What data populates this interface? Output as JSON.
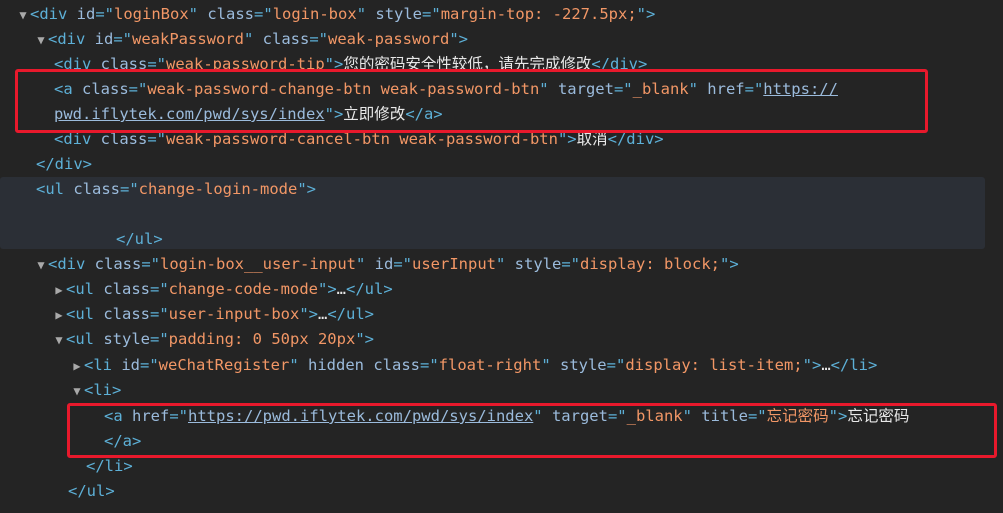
{
  "lines": [
    {
      "id": "l1",
      "toggle": "▼",
      "tokens": [
        {
          "t": "tag",
          "v": "<div "
        },
        {
          "t": "attr",
          "v": "id"
        },
        {
          "t": "tag",
          "v": "=\""
        },
        {
          "t": "val",
          "v": "loginBox"
        },
        {
          "t": "tag",
          "v": "\" "
        },
        {
          "t": "attr",
          "v": "class"
        },
        {
          "t": "tag",
          "v": "=\""
        },
        {
          "t": "val",
          "v": "login-box"
        },
        {
          "t": "tag",
          "v": "\" "
        },
        {
          "t": "attr",
          "v": "style"
        },
        {
          "t": "tag",
          "v": "=\""
        },
        {
          "t": "val",
          "v": "margin-top: -227.5px;"
        },
        {
          "t": "tag",
          "v": "\">"
        }
      ]
    },
    {
      "id": "l2",
      "toggle": "▼",
      "tokens": [
        {
          "t": "tag",
          "v": "<div "
        },
        {
          "t": "attr",
          "v": "id"
        },
        {
          "t": "tag",
          "v": "=\""
        },
        {
          "t": "val",
          "v": "weakPassword"
        },
        {
          "t": "tag",
          "v": "\" "
        },
        {
          "t": "attr",
          "v": "class"
        },
        {
          "t": "tag",
          "v": "=\""
        },
        {
          "t": "val",
          "v": "weak-password"
        },
        {
          "t": "tag",
          "v": "\">"
        }
      ]
    },
    {
      "id": "l3",
      "toggle": "",
      "tokens": [
        {
          "t": "tag",
          "v": "<div "
        },
        {
          "t": "attr",
          "v": "class"
        },
        {
          "t": "tag",
          "v": "=\""
        },
        {
          "t": "val",
          "v": "weak-password-tip"
        },
        {
          "t": "tag",
          "v": "\">"
        },
        {
          "t": "txt",
          "v": "您的密码安全性较低，请先完成修改"
        },
        {
          "t": "tag",
          "v": "</div>"
        }
      ]
    },
    {
      "id": "l4",
      "toggle": "",
      "tokens": [
        {
          "t": "tag",
          "v": "<a "
        },
        {
          "t": "attr",
          "v": "class"
        },
        {
          "t": "tag",
          "v": "=\""
        },
        {
          "t": "val",
          "v": "weak-password-change-btn weak-password-btn"
        },
        {
          "t": "tag",
          "v": "\" "
        },
        {
          "t": "attr",
          "v": "target"
        },
        {
          "t": "tag",
          "v": "=\""
        },
        {
          "t": "val",
          "v": "_blank"
        },
        {
          "t": "tag",
          "v": "\" "
        },
        {
          "t": "attr",
          "v": "href"
        },
        {
          "t": "tag",
          "v": "=\""
        },
        {
          "t": "link",
          "v": "https://"
        }
      ]
    },
    {
      "id": "l5",
      "toggle": "",
      "tokens": [
        {
          "t": "link",
          "v": "pwd.iflytek.com/pwd/sys/index"
        },
        {
          "t": "tag",
          "v": "\">"
        },
        {
          "t": "txt",
          "v": "立即修改"
        },
        {
          "t": "tag",
          "v": "</a>"
        }
      ]
    },
    {
      "id": "l6",
      "toggle": "",
      "tokens": [
        {
          "t": "tag",
          "v": "<div "
        },
        {
          "t": "attr",
          "v": "class"
        },
        {
          "t": "tag",
          "v": "=\""
        },
        {
          "t": "val",
          "v": "weak-password-cancel-btn weak-password-btn"
        },
        {
          "t": "tag",
          "v": "\">"
        },
        {
          "t": "txt",
          "v": "取消"
        },
        {
          "t": "tag",
          "v": "</div>"
        }
      ]
    },
    {
      "id": "l7",
      "toggle": "",
      "tokens": [
        {
          "t": "tag",
          "v": "</div>"
        }
      ]
    },
    {
      "id": "l8",
      "toggle": "",
      "tokens": [
        {
          "t": "tag",
          "v": "<ul "
        },
        {
          "t": "attr",
          "v": "class"
        },
        {
          "t": "tag",
          "v": "=\""
        },
        {
          "t": "val",
          "v": "change-login-mode"
        },
        {
          "t": "tag",
          "v": "\">"
        }
      ]
    },
    {
      "id": "l9",
      "toggle": "",
      "tokens": [
        {
          "t": "tag",
          "v": "</ul>"
        }
      ]
    },
    {
      "id": "l10",
      "toggle": "▼",
      "tokens": [
        {
          "t": "tag",
          "v": "<div "
        },
        {
          "t": "attr",
          "v": "class"
        },
        {
          "t": "tag",
          "v": "=\""
        },
        {
          "t": "val",
          "v": "login-box__user-input"
        },
        {
          "t": "tag",
          "v": "\" "
        },
        {
          "t": "attr",
          "v": "id"
        },
        {
          "t": "tag",
          "v": "=\""
        },
        {
          "t": "val",
          "v": "userInput"
        },
        {
          "t": "tag",
          "v": "\" "
        },
        {
          "t": "attr",
          "v": "style"
        },
        {
          "t": "tag",
          "v": "=\""
        },
        {
          "t": "val",
          "v": "display: block;"
        },
        {
          "t": "tag",
          "v": "\">"
        }
      ]
    },
    {
      "id": "l11",
      "toggle": "▶",
      "tokens": [
        {
          "t": "tag",
          "v": "<ul "
        },
        {
          "t": "attr",
          "v": "class"
        },
        {
          "t": "tag",
          "v": "=\""
        },
        {
          "t": "val",
          "v": "change-code-mode"
        },
        {
          "t": "tag",
          "v": "\">"
        },
        {
          "t": "ell",
          "v": "…"
        },
        {
          "t": "tag",
          "v": "</ul>"
        }
      ]
    },
    {
      "id": "l12",
      "toggle": "▶",
      "tokens": [
        {
          "t": "tag",
          "v": "<ul "
        },
        {
          "t": "attr",
          "v": "class"
        },
        {
          "t": "tag",
          "v": "=\""
        },
        {
          "t": "val",
          "v": "user-input-box"
        },
        {
          "t": "tag",
          "v": "\">"
        },
        {
          "t": "ell",
          "v": "…"
        },
        {
          "t": "tag",
          "v": "</ul>"
        }
      ]
    },
    {
      "id": "l13",
      "toggle": "▼",
      "tokens": [
        {
          "t": "tag",
          "v": "<ul "
        },
        {
          "t": "attr",
          "v": "style"
        },
        {
          "t": "tag",
          "v": "=\""
        },
        {
          "t": "val",
          "v": "padding: 0 50px 20px"
        },
        {
          "t": "tag",
          "v": "\">"
        }
      ]
    },
    {
      "id": "l14",
      "toggle": "▶",
      "tokens": [
        {
          "t": "tag",
          "v": "<li "
        },
        {
          "t": "attr",
          "v": "id"
        },
        {
          "t": "tag",
          "v": "=\""
        },
        {
          "t": "val",
          "v": "weChatRegister"
        },
        {
          "t": "tag",
          "v": "\" "
        },
        {
          "t": "attr",
          "v": "hidden class"
        },
        {
          "t": "tag",
          "v": "=\""
        },
        {
          "t": "val",
          "v": "float-right"
        },
        {
          "t": "tag",
          "v": "\" "
        },
        {
          "t": "attr",
          "v": "style"
        },
        {
          "t": "tag",
          "v": "=\""
        },
        {
          "t": "val",
          "v": "display: list-item;"
        },
        {
          "t": "tag",
          "v": "\">"
        },
        {
          "t": "ell",
          "v": "…"
        },
        {
          "t": "tag",
          "v": "</li>"
        }
      ]
    },
    {
      "id": "l15",
      "toggle": "▼",
      "tokens": [
        {
          "t": "tag",
          "v": "<li>"
        }
      ]
    },
    {
      "id": "l16",
      "toggle": "",
      "tokens": [
        {
          "t": "tag",
          "v": "<a "
        },
        {
          "t": "attr",
          "v": "href"
        },
        {
          "t": "tag",
          "v": "=\""
        },
        {
          "t": "link",
          "v": "https://pwd.iflytek.com/pwd/sys/index"
        },
        {
          "t": "tag",
          "v": "\" "
        },
        {
          "t": "attr",
          "v": "target"
        },
        {
          "t": "tag",
          "v": "=\""
        },
        {
          "t": "val",
          "v": "_blank"
        },
        {
          "t": "tag",
          "v": "\" "
        },
        {
          "t": "attr",
          "v": "title"
        },
        {
          "t": "tag",
          "v": "=\""
        },
        {
          "t": "val",
          "v": "忘记密码"
        },
        {
          "t": "tag",
          "v": "\">"
        },
        {
          "t": "txt",
          "v": "忘记密码"
        }
      ]
    },
    {
      "id": "l17",
      "toggle": "",
      "tokens": [
        {
          "t": "tag",
          "v": "</a>"
        }
      ]
    },
    {
      "id": "l18",
      "toggle": "",
      "tokens": [
        {
          "t": "tag",
          "v": "</li>"
        }
      ]
    },
    {
      "id": "l19",
      "toggle": "",
      "tokens": [
        {
          "t": "tag",
          "v": "</ul>"
        }
      ]
    }
  ],
  "colors": {
    "background": "#242424",
    "tag": "#5db0d7",
    "attribute": "#9bbbdc",
    "value": "#f29766",
    "text": "#e8e8e8",
    "highlight_box": "#e8192c",
    "hover_row": "#2b2f36"
  }
}
